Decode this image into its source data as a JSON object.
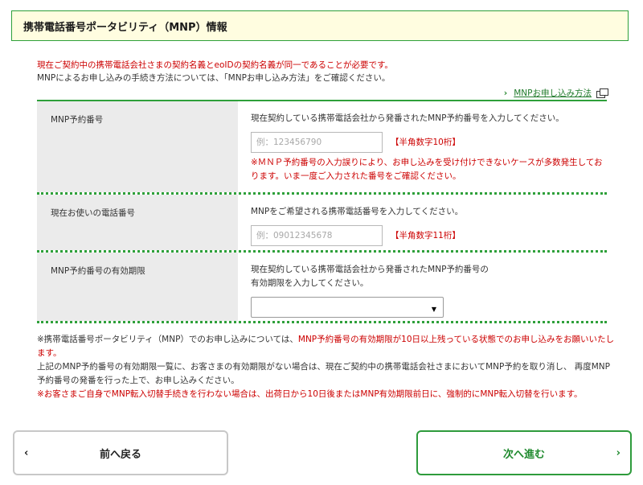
{
  "header": {
    "title": "携帯電話番号ポータビリティ（MNP）情報"
  },
  "notice": {
    "line1": "現在ご契約中の携帯電話会社さまの契約名義とeoIDの契約名義が同一であることが必要です。",
    "line2": "MNPによるお申し込みの手続き方法については、「MNPお申し込み方法」をご確認ください。"
  },
  "mnp_link": {
    "chevron": "›",
    "label": "MNPお申し込み方法",
    "icon": "external-window-icon"
  },
  "form": {
    "rows": [
      {
        "label": "MNP予約番号",
        "desc": "現在契約している携帯電話会社から発番されたMNP予約番号を入力してください。",
        "placeholder": "例：123456790",
        "hint": "【半角数字10桁】",
        "warn": "※ＭＮＰ予約番号の入力誤りにより、お申し込みを受け付けできないケースが多数発生しております。いま一度ご入力された番号をご確認ください。"
      },
      {
        "label": "現在お使いの電話番号",
        "desc": "MNPをご希望される携帯電話番号を入力してください。",
        "placeholder": "例：09012345678",
        "hint": "【半角数字11桁】"
      },
      {
        "label": "MNP予約番号の有効期限",
        "desc_line1": "現在契約している携帯電話会社から発番されたMNP予約番号の",
        "desc_line2": "有効期限を入力してください。",
        "select_value": "",
        "arrow": "▼"
      }
    ]
  },
  "footnotes": {
    "p1_black": "※携帯電話番号ポータビリティ（MNP）でのお申し込みについては、",
    "p1_red": "MNP予約番号の有効期限が10日以上残っている状態でのお申し込みをお願いいたします。",
    "p2": "上記のMNP予約番号の有効期限一覧に、お客さまの有効期限がない場合は、現在ご契約中の携帯電話会社さまにおいてMNP予約を取り消し、 再度MNP予約番号の発番を行った上で、お申し込みください。",
    "p3": "※お客さまご自身でMNP転入切替手続きを行わない場合は、出荷日から10日後またはMNP有効期限前日に、強制的にMNP転入切替を行います。"
  },
  "buttons": {
    "back_label": "前へ戻る",
    "back_chevron": "‹",
    "next_label": "次へ進む",
    "next_chevron": "›"
  },
  "colors": {
    "accent_green": "#2ea03a",
    "header_bg": "#fffde0",
    "warning_red": "#cc0000",
    "label_bg": "#ebebeb"
  }
}
